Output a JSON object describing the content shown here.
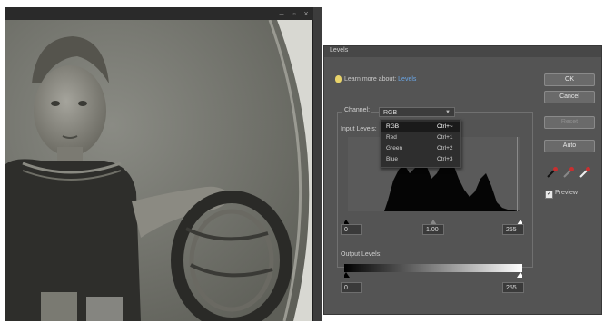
{
  "window": {
    "minimize_glyph": "–",
    "maximize_glyph": "▫",
    "close_glyph": "×"
  },
  "dialog": {
    "title": "Levels",
    "learn_more_prefix": "Learn more about:",
    "learn_more_link": "Levels",
    "channel_label": "Channel:",
    "channel_value": "RGB",
    "input_levels_label": "Input Levels:",
    "input_black": "0",
    "input_gamma": "1.00",
    "input_white": "255",
    "output_levels_label": "Output Levels:",
    "output_black": "0",
    "output_white": "255",
    "buttons": {
      "ok": "OK",
      "cancel": "Cancel",
      "reset": "Reset",
      "auto": "Auto"
    },
    "preview_label": "Preview",
    "preview_checked": true,
    "channels": [
      {
        "name": "RGB",
        "shortcut": "Ctrl+~"
      },
      {
        "name": "Red",
        "shortcut": "Ctrl+1"
      },
      {
        "name": "Green",
        "shortcut": "Ctrl+2"
      },
      {
        "name": "Blue",
        "shortcut": "Ctrl+3"
      }
    ],
    "icons": {
      "bulb": "lightbulb-icon",
      "eyedroppers": [
        "black-eyedropper-icon",
        "gray-eyedropper-icon",
        "white-eyedropper-icon"
      ]
    }
  },
  "colors": {
    "link": "#6aa6e6",
    "dialog_bg": "#545454"
  }
}
